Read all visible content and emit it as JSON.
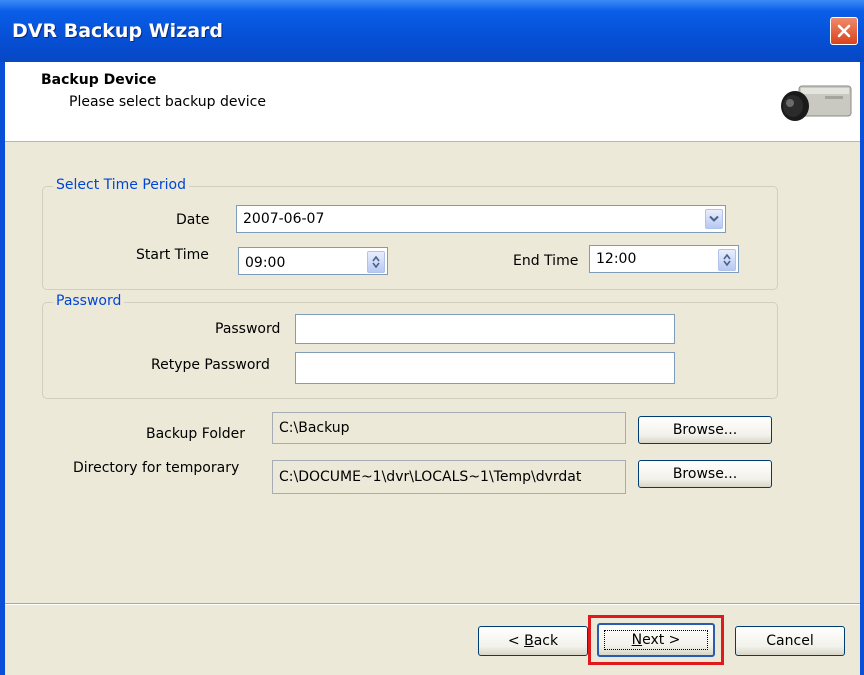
{
  "window": {
    "title": "DVR Backup Wizard"
  },
  "header": {
    "title": "Backup Device",
    "subtitle": "Please select backup device",
    "icon": "camera-icon"
  },
  "time_period": {
    "legend": "Select Time Period",
    "date_label": "Date",
    "date_value": "2007-06-07",
    "start_label": "Start Time",
    "start_value": "09:00",
    "end_label": "End Time",
    "end_value": "12:00"
  },
  "password": {
    "legend": "Password",
    "password_label": "Password",
    "password_value": "",
    "retype_label": "Retype Password",
    "retype_value": ""
  },
  "backup_folder": {
    "label": "Backup Folder",
    "value": "C:\\Backup",
    "browse_label": "Browse..."
  },
  "temp_directory": {
    "label": "Directory for temporary",
    "value": "C:\\DOCUME~1\\dvr\\LOCALS~1\\Temp\\dvrdat",
    "browse_label": "Browse..."
  },
  "buttons": {
    "back_prefix": "< ",
    "back_accel": "B",
    "back_rest": "ack",
    "next_accel": "N",
    "next_rest": "ext >",
    "cancel_label": "Cancel"
  },
  "colors": {
    "title_bar": "#0650d6",
    "group_legend": "#0046d5",
    "highlight": "#e0191c"
  }
}
